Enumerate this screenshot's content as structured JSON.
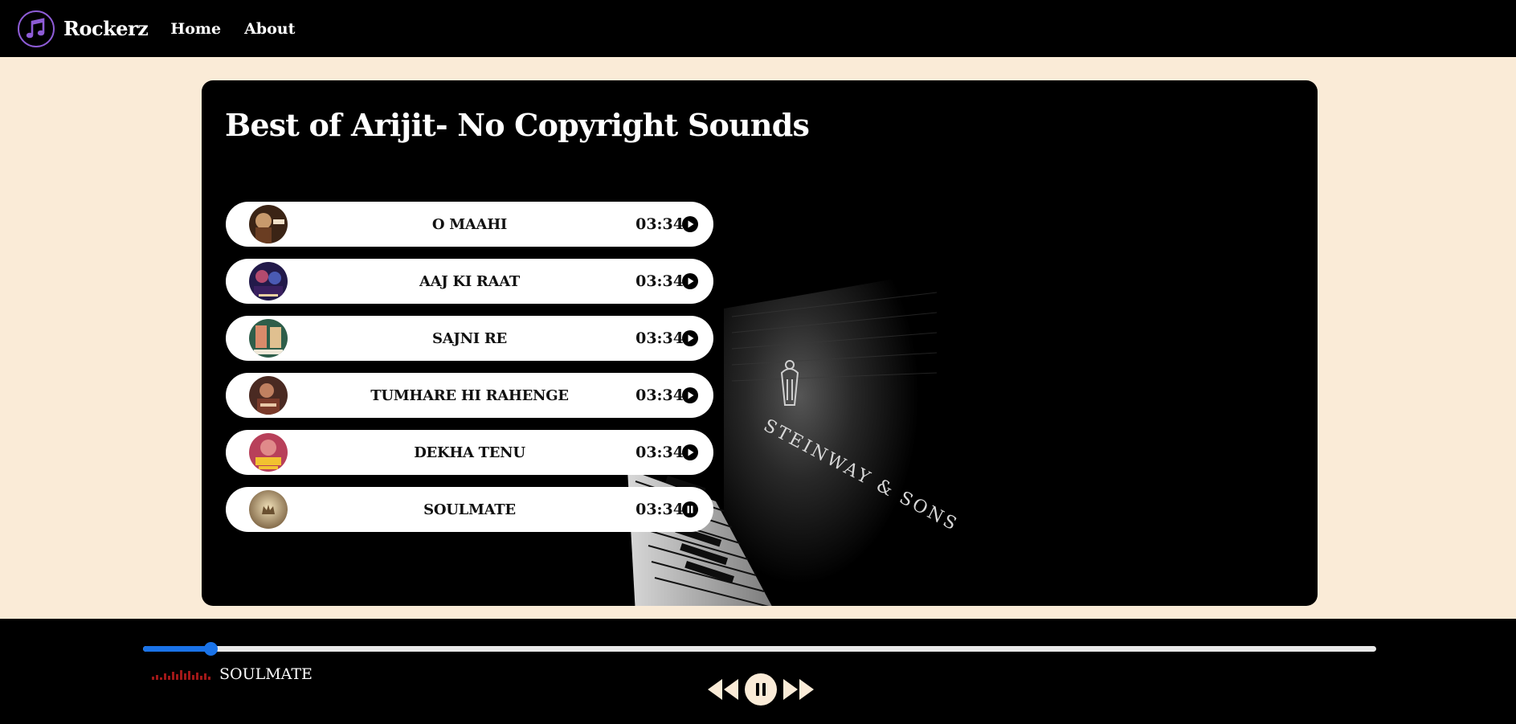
{
  "app": {
    "brand": "Rockerz",
    "nav": [
      {
        "label": "Home"
      },
      {
        "label": "About"
      }
    ],
    "logo_icon": "music-note-icon",
    "accent": "#8e5cd6"
  },
  "playlist": {
    "title": "Best of Arijit- No Copyright Sounds",
    "songs": [
      {
        "name": "O MAAHI",
        "duration": "03:34",
        "state": "play",
        "cover": "cover-o-maahi"
      },
      {
        "name": "AAJ KI RAAT",
        "duration": "03:34",
        "state": "play",
        "cover": "cover-aaj-ki-raat"
      },
      {
        "name": "SAJNI RE",
        "duration": "03:34",
        "state": "play",
        "cover": "cover-sajni-re"
      },
      {
        "name": "TUMHARE HI RAHENGE",
        "duration": "03:34",
        "state": "play",
        "cover": "cover-tumhare-hi-rahenge"
      },
      {
        "name": "DEKHA TENU",
        "duration": "03:34",
        "state": "play",
        "cover": "cover-dekha-tenu"
      },
      {
        "name": "SOULMATE",
        "duration": "03:34",
        "state": "pause",
        "cover": "cover-soulmate"
      }
    ],
    "background_text": "STEINWAY & SONS"
  },
  "player": {
    "current_song": "SOULMATE",
    "progress_fraction": 0.055,
    "progress_color": "#1a73e8",
    "controls": [
      "previous-icon",
      "pause-icon",
      "next-icon"
    ]
  }
}
